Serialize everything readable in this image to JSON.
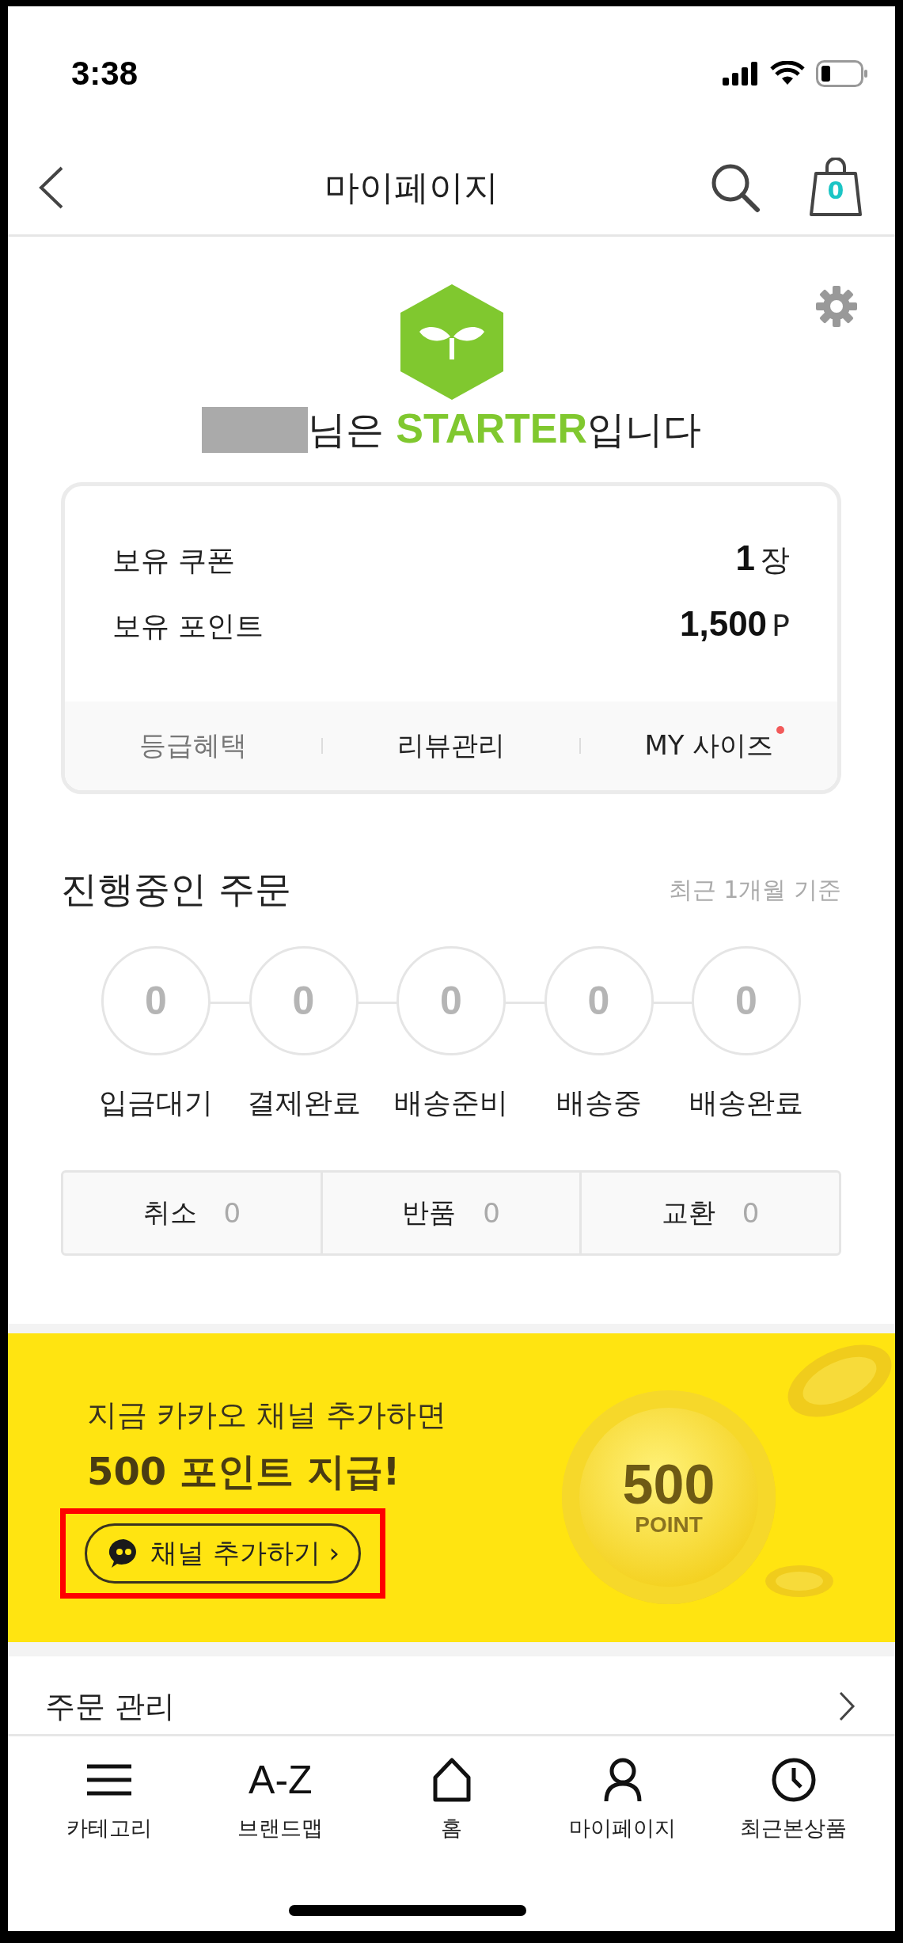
{
  "status_bar": {
    "time": "3:38"
  },
  "header": {
    "title": "마이페이지",
    "cart_count": "0"
  },
  "profile": {
    "greeting": "님은 **STARTER**입니다"
  },
  "summary": {
    "rows": [
      {
        "label": "보유 쿠폰",
        "value": "1",
        "unit": "장"
      },
      {
        "label": "보유 포인트",
        "value": "1,500",
        "unit": "P"
      }
    ],
    "links": [
      {
        "label": "등급혜택",
        "dimmed": true,
        "new_dot": false
      },
      {
        "label": "리뷰관리",
        "dimmed": false,
        "new_dot": false
      },
      {
        "label": "MY 사이즈",
        "dimmed": false,
        "new_dot": true
      }
    ]
  },
  "orders": {
    "title": "진행중인 주문",
    "period": "최근 1개월 기준",
    "steps": [
      {
        "count": "0",
        "label": "입금대기"
      },
      {
        "count": "0",
        "label": "결제완료"
      },
      {
        "count": "0",
        "label": "배송준비"
      },
      {
        "count": "0",
        "label": "배송중"
      },
      {
        "count": "0",
        "label": "배송완료"
      }
    ],
    "claims": [
      {
        "label": "취소",
        "count": "0"
      },
      {
        "label": "반품",
        "count": "0"
      },
      {
        "label": "교환",
        "count": "0"
      }
    ]
  },
  "banner": {
    "line": "지금 카카오 채널 추가하면",
    "headline": "500 포인트 지급!",
    "button": "채널 추가하기 ›",
    "coin_value": "500",
    "coin_unit": "POINT"
  },
  "order_management": {
    "title": "주문 관리"
  },
  "tab_bar": {
    "items": [
      {
        "kind": "menu",
        "label": "카테고리"
      },
      {
        "kind": "text",
        "glyph": "A-Z",
        "label": "브랜드맵"
      },
      {
        "kind": "home",
        "label": "홈"
      },
      {
        "kind": "person",
        "label": "마이페이지"
      },
      {
        "kind": "clock",
        "label": "최근본상품"
      }
    ]
  }
}
